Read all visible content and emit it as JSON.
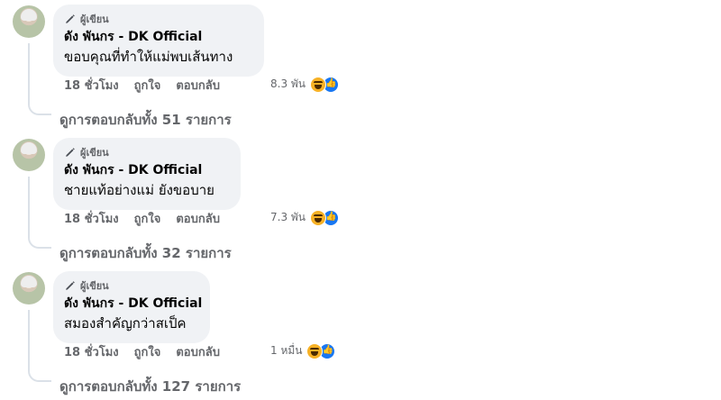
{
  "comments": [
    {
      "author_badge": "ผู้เขียน",
      "name": "ดัง พันกร - DK Official",
      "text": "ขอบคุณที่ทำให้แม่พบเส้นทาง",
      "time": "18 ชั่วโมง",
      "like": "ถูกใจ",
      "reply": "ตอบกลับ",
      "reaction_count": "8.3 พัน",
      "reactions": [
        "haha-icon",
        "like-icon"
      ],
      "replies_link": "ดูการตอบกลับทั้ง 51 รายการ"
    },
    {
      "author_badge": "ผู้เขียน",
      "name": "ดัง พันกร - DK Official",
      "text": "ชายแท้อย่างแม่ ยังขอบาย",
      "time": "18 ชั่วโมง",
      "like": "ถูกใจ",
      "reply": "ตอบกลับ",
      "reaction_count": "7.3 พัน",
      "reactions": [
        "haha-icon",
        "like-icon"
      ],
      "replies_link": "ดูการตอบกลับทั้ง 32 รายการ"
    },
    {
      "author_badge": "ผู้เขียน",
      "name": "ดัง พันกร - DK Official",
      "text": "สมองสำคัญกว่าสเป็ค",
      "time": "18 ชั่วโมง",
      "like": "ถูกใจ",
      "reply": "ตอบกลับ",
      "reaction_count": "1 หมื่น",
      "reactions": [
        "haha-icon",
        "like-icon"
      ],
      "replies_link": "ดูการตอบกลับทั้ง 127 รายการ"
    }
  ],
  "colors": {
    "bubble": "#f0f2f5",
    "secondary_text": "#65676b",
    "like_blue": "#1877f2",
    "haha_yellow": "#f7b125"
  }
}
